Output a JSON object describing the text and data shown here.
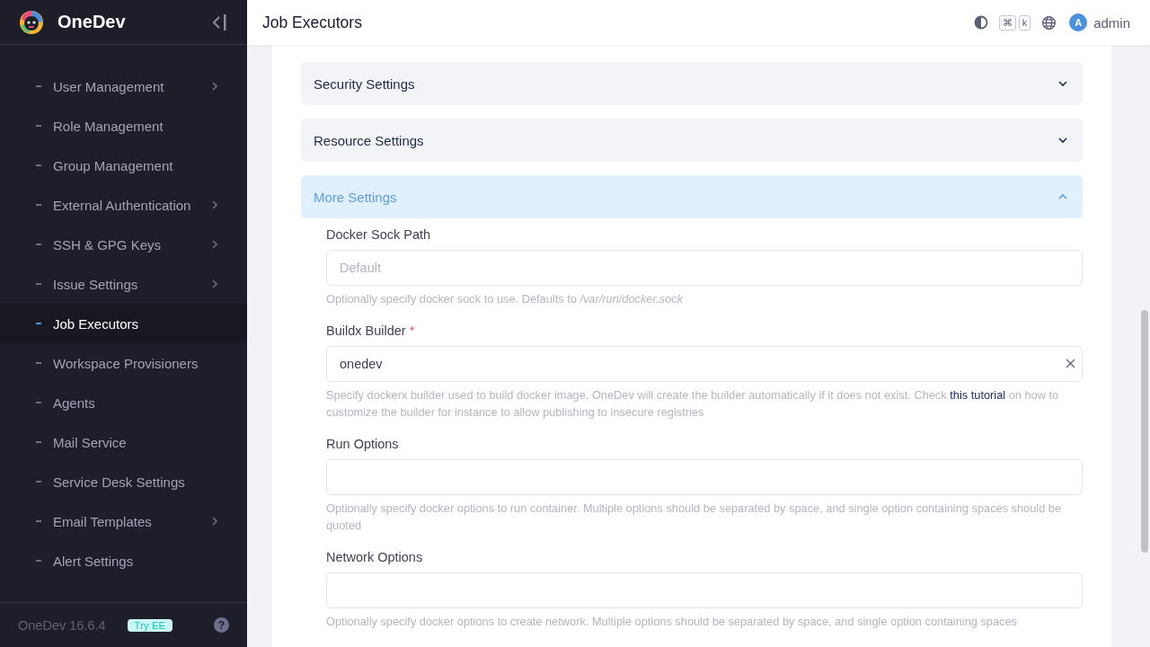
{
  "brand": {
    "name": "OneDev"
  },
  "sidebar": {
    "items": [
      {
        "label": "User Management",
        "has_submenu": true,
        "selected": false
      },
      {
        "label": "Role Management",
        "has_submenu": false,
        "selected": false
      },
      {
        "label": "Group Management",
        "has_submenu": false,
        "selected": false
      },
      {
        "label": "External Authentication",
        "has_submenu": true,
        "selected": false
      },
      {
        "label": "SSH & GPG Keys",
        "has_submenu": true,
        "selected": false
      },
      {
        "label": "Issue Settings",
        "has_submenu": true,
        "selected": false
      },
      {
        "label": "Job Executors",
        "has_submenu": false,
        "selected": true
      },
      {
        "label": "Workspace Provisioners",
        "has_submenu": false,
        "selected": false
      },
      {
        "label": "Agents",
        "has_submenu": false,
        "selected": false
      },
      {
        "label": "Mail Service",
        "has_submenu": false,
        "selected": false
      },
      {
        "label": "Service Desk Settings",
        "has_submenu": false,
        "selected": false
      },
      {
        "label": "Email Templates",
        "has_submenu": true,
        "selected": false
      },
      {
        "label": "Alert Settings",
        "has_submenu": false,
        "selected": false
      }
    ],
    "version": "OneDev 16.6.4",
    "badge": "Try EE",
    "help": "?"
  },
  "header": {
    "title": "Job Executors",
    "keys": [
      "⌘",
      "k"
    ],
    "avatar": "A",
    "user": "admin"
  },
  "form": {
    "required_mark": "*",
    "sections": [
      {
        "title": "Security Settings",
        "expanded": false
      },
      {
        "title": "Resource Settings",
        "expanded": false
      },
      {
        "title": "More Settings",
        "expanded": true
      }
    ],
    "fields": [
      {
        "label": "Docker Sock Path",
        "required": false,
        "placeholder": "Default",
        "clearable": false,
        "hint": "Optionally specify docker sock to use. Defaults to */var/run/docker.sock*"
      },
      {
        "label": "Buildx Builder",
        "required": true,
        "value": "onedev",
        "clearable": true,
        "hint": "Specify dockerx builder used to build docker image. OneDev will create the builder automatically if it does not exist. Check",
        "link": "this tutorial",
        "hint_after": "on how to customize the builder for instance to allow publishing to insecure registries"
      },
      {
        "label": "Run Options",
        "required": false,
        "clearable": false,
        "hint": "Optionally specify docker options to run container. Multiple options should be separated by space, and single option containing spaces should be quoted"
      },
      {
        "label": "Network Options",
        "required": false,
        "clearable": false,
        "hint": "Optionally specify docker options to create network. Multiple options should be separated by space, and single option containing spaces"
      }
    ]
  }
}
